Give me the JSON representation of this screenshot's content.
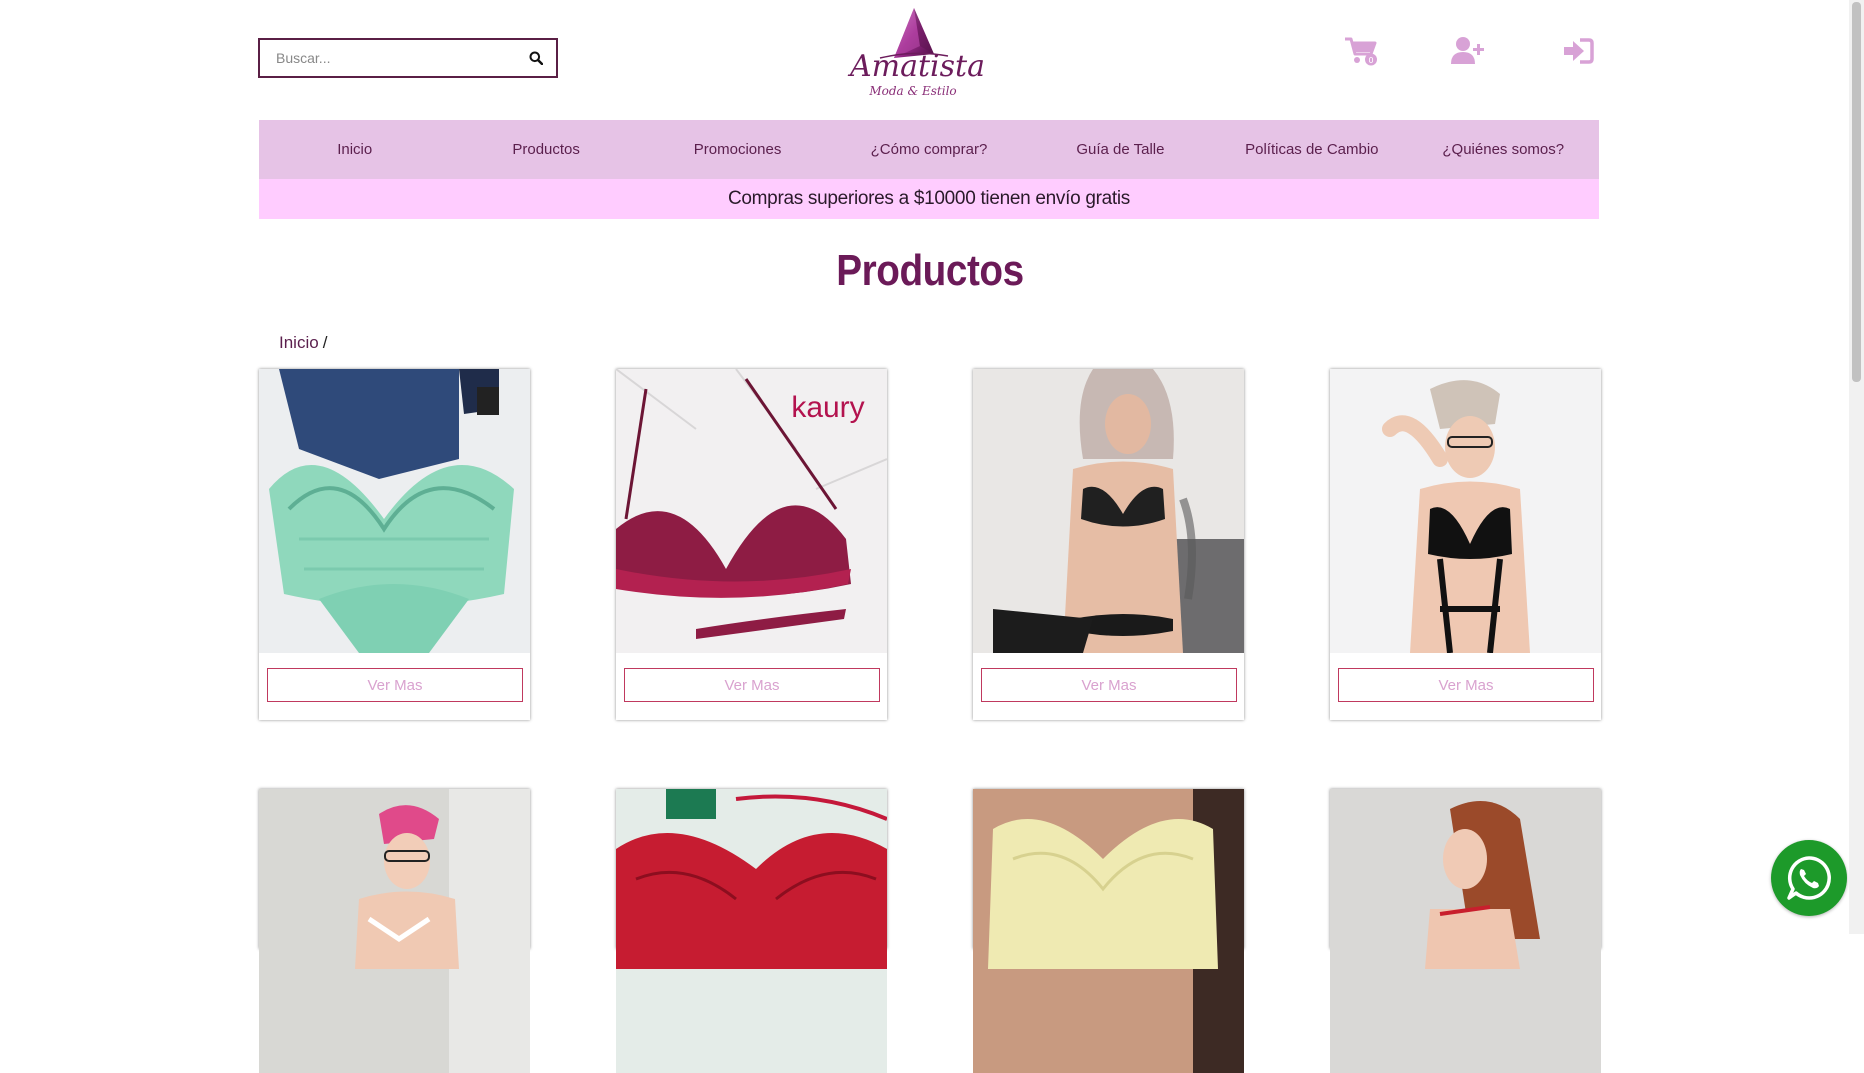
{
  "search": {
    "placeholder": "Buscar..."
  },
  "logo": {
    "name": "Amatista",
    "tagline": "Moda & Estilo"
  },
  "nav": {
    "items": [
      "Inicio",
      "Productos",
      "Promociones",
      "¿Cómo comprar?",
      "Guía de Talle",
      "Políticas de Cambio",
      "¿Quiénes somos?"
    ]
  },
  "promo": {
    "text": "Compras superiores a $10000 tienen envío gratis"
  },
  "page": {
    "title": "Productos"
  },
  "breadcrumb": {
    "home": "Inicio",
    "separator": "/"
  },
  "products": {
    "button_label": "Ver Mas",
    "items": [
      {
        "photo": "mint green lace bralette set",
        "brand_overlay": ""
      },
      {
        "photo": "burgundy lace bralette",
        "brand_overlay": "kaury"
      },
      {
        "photo": "model in black leather bra",
        "brand_overlay": ""
      },
      {
        "photo": "model in black lace bodysuit",
        "brand_overlay": ""
      },
      {
        "photo": "model with pink hair in white lace",
        "brand_overlay": ""
      },
      {
        "photo": "red lace bra",
        "brand_overlay": ""
      },
      {
        "photo": "pale yellow bra",
        "brand_overlay": ""
      },
      {
        "photo": "model with auburn hair",
        "brand_overlay": ""
      }
    ]
  },
  "colors": {
    "nav_bg": "#e6c3e6",
    "promo_bg": "#ffccff",
    "title": "#6b1a58",
    "icon": "#d8a2d6",
    "whatsapp": "#1d9a2a"
  },
  "icons": [
    "search-icon",
    "cart-icon",
    "user-plus-icon",
    "sign-in-icon",
    "whatsapp-icon"
  ]
}
